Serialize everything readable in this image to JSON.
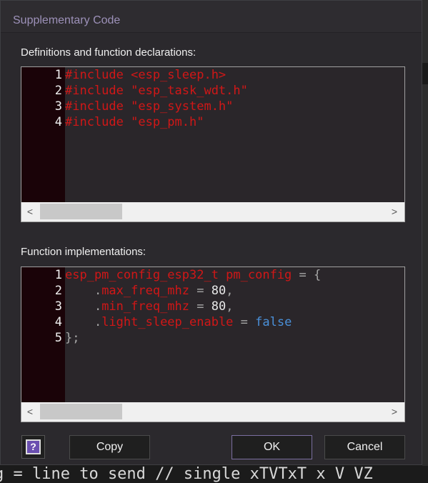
{
  "dialog": {
    "title": "Supplementary Code"
  },
  "sections": {
    "definitions": {
      "label": "Definitions and function declarations:",
      "lines": [
        {
          "n": "1",
          "tokens": [
            {
              "t": "#include <esp_sleep.h>",
              "c": "pp"
            }
          ]
        },
        {
          "n": "2",
          "tokens": [
            {
              "t": "#include \"esp_task_wdt.h\"",
              "c": "pp"
            }
          ]
        },
        {
          "n": "3",
          "tokens": [
            {
              "t": "#include \"esp_system.h\"",
              "c": "pp"
            }
          ]
        },
        {
          "n": "4",
          "tokens": [
            {
              "t": "#include \"esp_pm.h\"",
              "c": "pp"
            }
          ]
        }
      ]
    },
    "implementations": {
      "label": "Function implementations:",
      "lines": [
        {
          "n": "1",
          "tokens": [
            {
              "t": "esp_pm_config_esp32_t pm_config",
              "c": "id"
            },
            {
              "t": " = {",
              "c": "op"
            }
          ]
        },
        {
          "n": "2",
          "tokens": [
            {
              "t": "    .",
              "c": "op"
            },
            {
              "t": "max_freq_mhz",
              "c": "id"
            },
            {
              "t": " = ",
              "c": "op"
            },
            {
              "t": "80",
              "c": "num"
            },
            {
              "t": ",",
              "c": "op"
            }
          ]
        },
        {
          "n": "3",
          "tokens": [
            {
              "t": "    .",
              "c": "op"
            },
            {
              "t": "min_freq_mhz",
              "c": "id"
            },
            {
              "t": " = ",
              "c": "op"
            },
            {
              "t": "80",
              "c": "num"
            },
            {
              "t": ",",
              "c": "op"
            }
          ]
        },
        {
          "n": "4",
          "tokens": [
            {
              "t": "    .",
              "c": "op"
            },
            {
              "t": "light_sleep_enable",
              "c": "id"
            },
            {
              "t": " = ",
              "c": "op"
            },
            {
              "t": "false",
              "c": "kw"
            }
          ]
        },
        {
          "n": "5",
          "tokens": [
            {
              "t": "};",
              "c": "op"
            }
          ]
        }
      ]
    }
  },
  "scrollbar": {
    "left_arrow": "<",
    "right_arrow": ">"
  },
  "buttons": {
    "help": "?",
    "copy": "Copy",
    "ok": "OK",
    "cancel": "Cancel"
  },
  "background_text": "g = line to send  // single xTVTxT x V VZ"
}
